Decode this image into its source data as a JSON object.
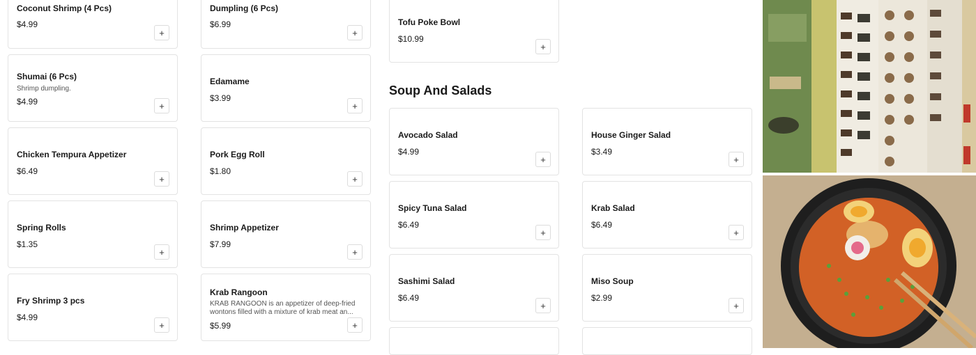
{
  "add_symbol": "+",
  "section": {
    "soup_title": "Soup And Salads"
  },
  "items": {
    "coconut_shrimp": {
      "name": "Coconut Shrimp (4 Pcs)",
      "price": "$4.99"
    },
    "shumai": {
      "name": "Shumai (6 Pcs)",
      "desc": "Shrimp dumpling.",
      "price": "$4.99"
    },
    "chicken_tempura": {
      "name": "Chicken Tempura Appetizer",
      "price": "$6.49"
    },
    "spring_rolls": {
      "name": "Spring Rolls",
      "price": "$1.35"
    },
    "fry_shrimp": {
      "name": "Fry Shrimp 3 pcs",
      "price": "$4.99"
    },
    "dumpling": {
      "name": "Dumpling (6 Pcs)",
      "price": "$6.99"
    },
    "edamame": {
      "name": "Edamame",
      "price": "$3.99"
    },
    "pork_egg_roll": {
      "name": "Pork Egg Roll",
      "price": "$1.80"
    },
    "shrimp_appetizer": {
      "name": "Shrimp Appetizer",
      "price": "$7.99"
    },
    "krab_rangoon": {
      "name": "Krab Rangoon",
      "desc": "KRAB RANGOON is an appetizer of deep-fried wontons filled with a mixture of krab meat an...",
      "price": "$5.99"
    },
    "tofu_poke_bowl": {
      "name": "Tofu Poke Bowl",
      "price": "$10.99"
    },
    "avocado_salad": {
      "name": "Avocado Salad",
      "price": "$4.99"
    },
    "house_ginger_salad": {
      "name": "House Ginger Salad",
      "price": "$3.49"
    },
    "spicy_tuna_salad": {
      "name": "Spicy Tuna Salad",
      "price": "$6.49"
    },
    "krab_salad": {
      "name": "Krab Salad",
      "price": "$6.49"
    },
    "sashimi_salad": {
      "name": "Sashimi Salad",
      "price": "$6.49"
    },
    "miso_soup": {
      "name": "Miso Soup",
      "price": "$2.99"
    }
  },
  "colors": {
    "card_border": "#e3e3e3",
    "text": "#1a1a1a",
    "muted": "#555555"
  }
}
